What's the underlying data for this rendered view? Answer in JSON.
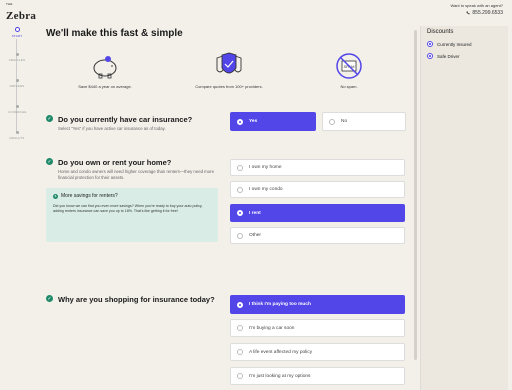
{
  "brand": {
    "the": "THE",
    "word": "Zebra"
  },
  "agent": {
    "prompt": "Want to speak with an agent?",
    "phone": "855.299.6533"
  },
  "stepper": [
    "START",
    "VEHICLES",
    "DRIVERS",
    "COVERAGE",
    "RESULTS"
  ],
  "main": {
    "title": "We'll make this fast & simple",
    "benefits": [
      {
        "icon": "piggy-bank-icon",
        "text": "Save $440 a year on average."
      },
      {
        "icon": "shields-icon",
        "text": "Compare quotes from 100+ providers."
      },
      {
        "icon": "no-spam-icon",
        "text": "No spam."
      }
    ]
  },
  "q1": {
    "title": "Do you currently have car insurance?",
    "sub": "Select \"Yes\" if you have active car insurance as of today.",
    "options": [
      "Yes",
      "No"
    ]
  },
  "q2": {
    "title": "Do you own or rent your home?",
    "sub": "Home and condo owners will need higher coverage than renters—they need more financial protection for their assets.",
    "options": [
      "I own my home",
      "I own my condo",
      "I rent",
      "Other"
    ],
    "savings": {
      "title": "More savings for renters?",
      "body": "Did you know we can find you even more savings? When you're ready to buy your auto policy, adding renters insurance can save you up to 18%. That's like getting it for free!"
    }
  },
  "q3": {
    "title": "Why are you shopping for insurance today?",
    "options": [
      "I think I'm paying too much",
      "I'm buying a car soon",
      "A life event affected my policy",
      "I'm just looking at my options"
    ]
  },
  "discounts": {
    "title": "Discounts",
    "items": [
      "Currently Insured",
      "Safe Driver"
    ]
  },
  "colors": {
    "accent": "#5346e8",
    "check": "#1f8a6a",
    "background": "#f3f0ea"
  }
}
